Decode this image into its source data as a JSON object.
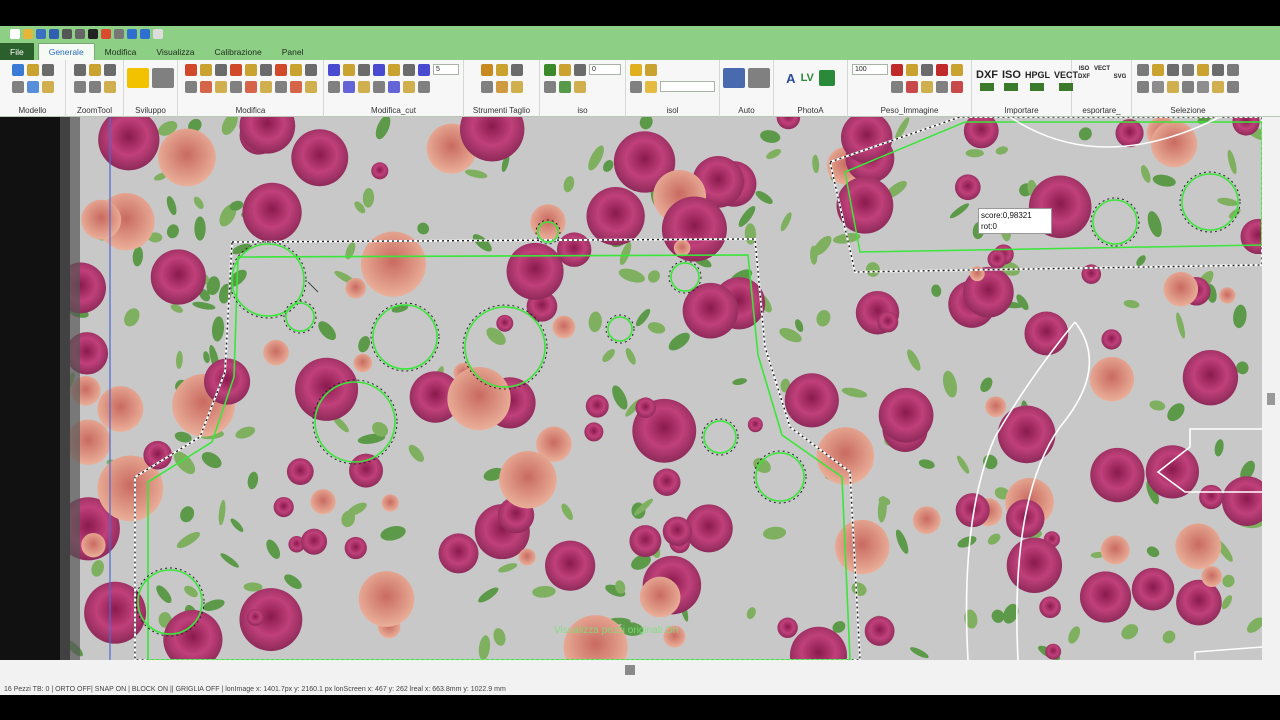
{
  "quick_access": {
    "icons": [
      "new-file-icon",
      "open-icon",
      "save-icon",
      "save-all-icon",
      "print-icon",
      "print-preview-icon",
      "flag-icon",
      "palette-icon",
      "gear-icon",
      "info-icon",
      "help-icon",
      "dropdown-arrow-icon"
    ],
    "colors": [
      "#ffffff",
      "#e7b53a",
      "#3b6fc0",
      "#2f5fb0",
      "#555555",
      "#666666",
      "#222222",
      "#d94a2f",
      "#777777",
      "#2f6fd0",
      "#2f6fd0",
      "#dddddd"
    ]
  },
  "menu": {
    "file": "File",
    "tabs": [
      "Generale",
      "Modifica",
      "Visualizza",
      "Calibrazione",
      "Panel"
    ],
    "active_tab": "Generale"
  },
  "ribbon": {
    "groups": [
      {
        "key": "modello",
        "label": "Modello",
        "icons": 6,
        "color": "#3a7bd5"
      },
      {
        "key": "zoomtool",
        "label": "ZoomTool",
        "icons": 6,
        "color": "#6a6a6a"
      },
      {
        "key": "sviluppo",
        "label": "Sviluppo",
        "icons": 2,
        "color": "#f2c200"
      },
      {
        "key": "modifica",
        "label": "Modifica",
        "icons": 18,
        "color": "#d04a2a"
      },
      {
        "key": "modifica_cut",
        "label": "Modifica_cut",
        "icons": 14,
        "color": "#4a4ad0"
      },
      {
        "key": "strumenti_taglio",
        "label": "Strumenti Taglio",
        "icons": 6,
        "color": "#c88a20"
      },
      {
        "key": "iso",
        "label": "iso",
        "icons": 6,
        "color": "#3a8a2a"
      },
      {
        "key": "isol",
        "label": "isol",
        "icons": 4,
        "color": "#e0b020"
      },
      {
        "key": "auto",
        "label": "Auto",
        "icons": 2,
        "color": "#4a6ab0"
      },
      {
        "key": "photoa",
        "label": "PhotoA",
        "icons": 3,
        "color": "#2a8a3a"
      },
      {
        "key": "peso_immagine",
        "label": "Peso_Immagine",
        "icons": 10,
        "color": "#c02a2a"
      },
      {
        "key": "importare",
        "label": "Importare",
        "icons": 4,
        "color": "#2a6a2a"
      },
      {
        "key": "esportare",
        "label": "esportare_",
        "icons": 4,
        "color": "#2a6a2a"
      },
      {
        "key": "selezione",
        "label": "Selezione",
        "icons": 14,
        "color": "#7a7a7a"
      }
    ],
    "modifica_cut_spin": "5",
    "iso_spin": "0",
    "peso_spin": "100",
    "import_formats": [
      "DXF",
      "ISO",
      "HPGL",
      "VECT"
    ],
    "export_formats": [
      "ISO",
      "VECT",
      "DXF",
      "SVG"
    ],
    "auto_color": "#6a8ac8",
    "photoa_label": "A",
    "photoa_lv": "LV"
  },
  "canvas": {
    "background": "#c8c8c8",
    "outline_color": "#39e639",
    "cut_line_color": "#ffffff"
  },
  "tooltip": {
    "score": "score:0,98321",
    "rot": "rot:0"
  },
  "overlay": {
    "message": "Visualizza pezzi originali On"
  },
  "status": {
    "text": "16 Pezzi TB: 0   | ORTO OFF| SNAP ON | BLOCK ON || GRIGLIA OFF |    lonImage x: 1401.7px y: 2160.1 px lonScreen x: 467 y: 262 lreal x: 663.8mm y: 1022.9 mm"
  }
}
